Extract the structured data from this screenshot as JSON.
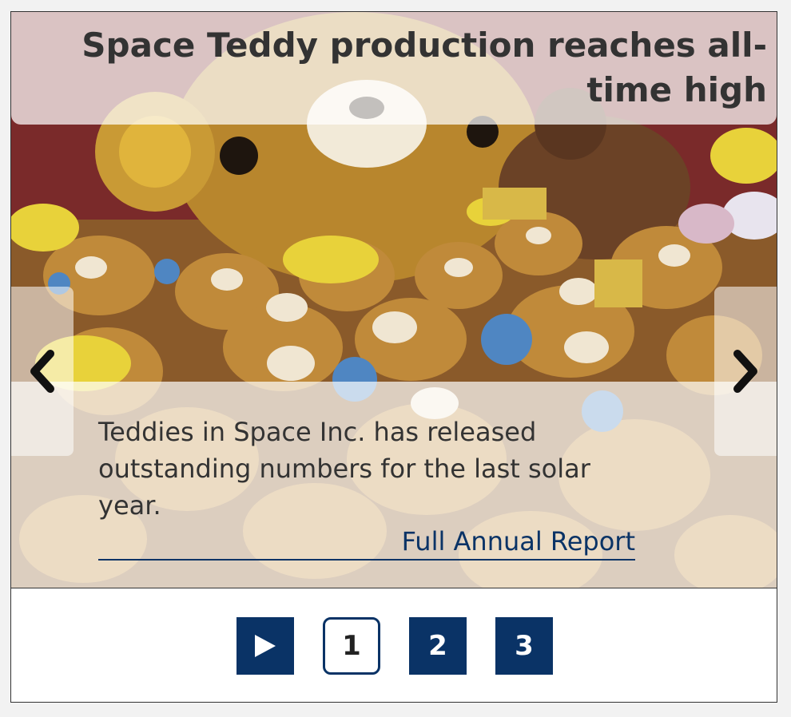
{
  "slide": {
    "headline": "Space Teddy production reaches all-time high",
    "caption": "Teddies in Space Inc. has released outstanding numbers for the last solar year.",
    "link_label": "Full Annual Report"
  },
  "nav": {
    "prev_icon": "chevron-left-icon",
    "next_icon": "chevron-right-icon"
  },
  "controls": {
    "play_icon": "play-icon",
    "pages": [
      "1",
      "2",
      "3"
    ],
    "active_page": "1"
  },
  "colors": {
    "accent": "#0a3366",
    "text": "#333333"
  }
}
